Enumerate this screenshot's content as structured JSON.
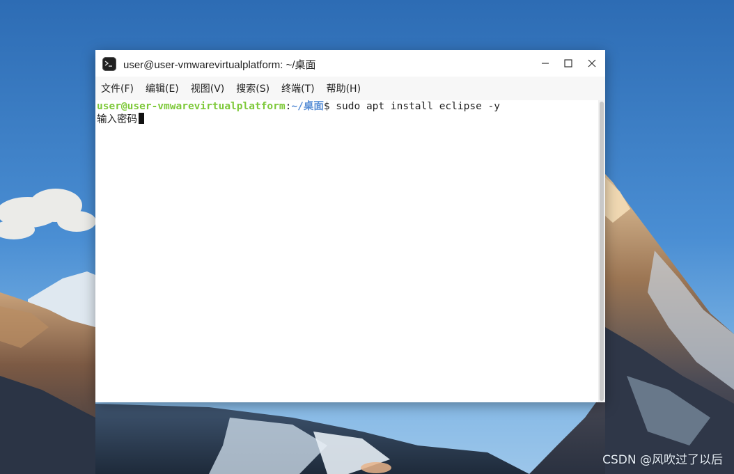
{
  "window": {
    "title": "user@user-vmwarevirtualplatform: ~/桌面",
    "controls": {
      "minimize": "minimize-icon",
      "maximize": "maximize-icon",
      "close": "close-icon"
    }
  },
  "menubar": {
    "items": [
      {
        "label": "文件(F)"
      },
      {
        "label": "编辑(E)"
      },
      {
        "label": "视图(V)"
      },
      {
        "label": "搜索(S)"
      },
      {
        "label": "终端(T)"
      },
      {
        "label": "帮助(H)"
      }
    ]
  },
  "terminal": {
    "prompt_user_host": "user@user-vmwarevirtualplatform",
    "prompt_sep": ":",
    "prompt_path": "~/桌面",
    "prompt_symbol": "$",
    "command": " sudo apt install eclipse -y",
    "password_prompt": "输入密码"
  },
  "colors": {
    "prompt_user": "#7ec93a",
    "prompt_path": "#5a8fd6",
    "window_bg": "#ffffff",
    "menubar_bg": "#f7f7f7"
  },
  "desktop": {
    "watermark": "CSDN @风吹过了以后"
  }
}
